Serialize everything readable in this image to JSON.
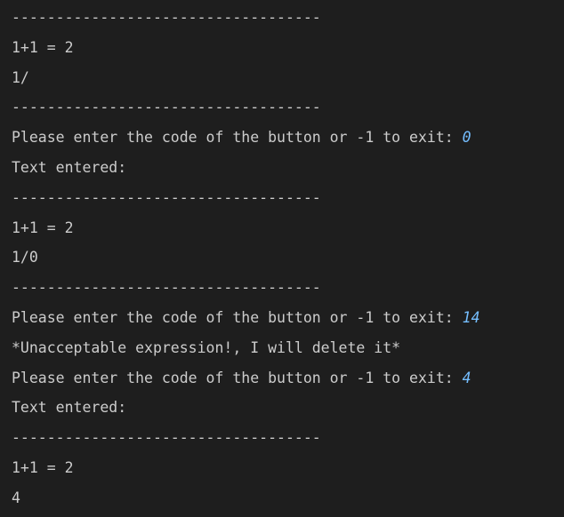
{
  "terminal": {
    "lines": [
      {
        "kind": "separator",
        "text": "-----------------------------------"
      },
      {
        "kind": "output",
        "text": "1+1 = 2"
      },
      {
        "kind": "output",
        "text": "1/"
      },
      {
        "kind": "separator",
        "text": "-----------------------------------"
      },
      {
        "kind": "prompt",
        "text": "Please enter the code of the button or -1 to exit: ",
        "input": "0"
      },
      {
        "kind": "output",
        "text": "Text entered:"
      },
      {
        "kind": "separator",
        "text": "-----------------------------------"
      },
      {
        "kind": "output",
        "text": "1+1 = 2"
      },
      {
        "kind": "output",
        "text": "1/0"
      },
      {
        "kind": "separator",
        "text": "-----------------------------------"
      },
      {
        "kind": "prompt",
        "text": "Please enter the code of the button or -1 to exit: ",
        "input": "14"
      },
      {
        "kind": "output",
        "text": "*Unacceptable expression!, I will delete it*"
      },
      {
        "kind": "prompt",
        "text": "Please enter the code of the button or -1 to exit: ",
        "input": "4"
      },
      {
        "kind": "output",
        "text": "Text entered:"
      },
      {
        "kind": "separator",
        "text": "-----------------------------------"
      },
      {
        "kind": "output",
        "text": "1+1 = 2"
      },
      {
        "kind": "output",
        "text": "4"
      }
    ]
  },
  "colors": {
    "background": "#1e1e1e",
    "text": "#cccccc",
    "user_input": "#75beff"
  }
}
